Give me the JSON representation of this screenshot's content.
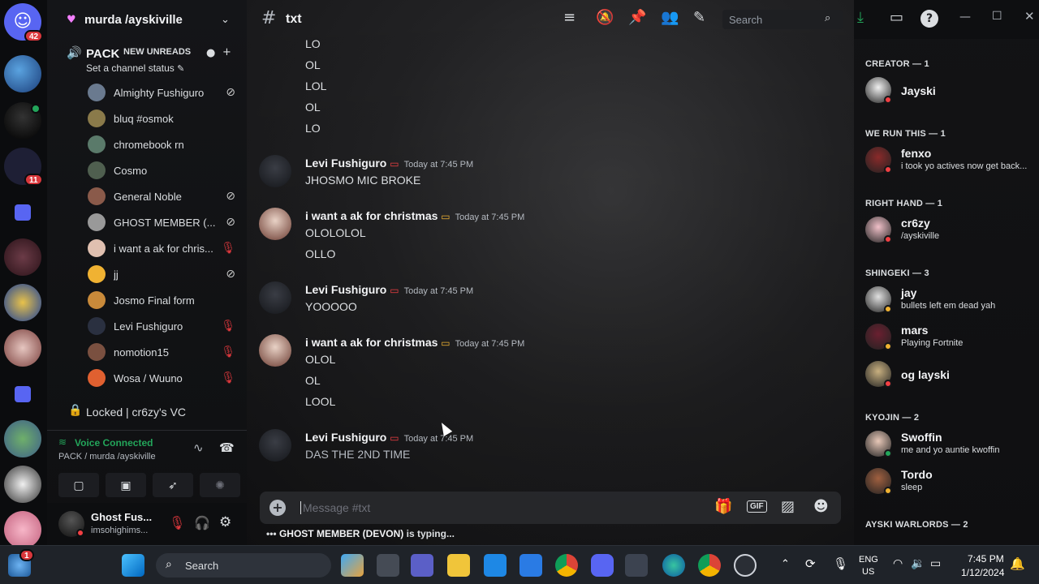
{
  "rail": {
    "badges": [
      "42",
      "11",
      "1"
    ]
  },
  "sidebar": {
    "server_name": "murda /ayskiville",
    "voice_channel": "PACK",
    "new_unreads": "NEW UNREADS",
    "channel_status": "Set a channel status",
    "voice_users": [
      {
        "name": "Almighty Fushiguro",
        "state": "deafened"
      },
      {
        "name": "bluq #osmok",
        "state": ""
      },
      {
        "name": "chromebook rn",
        "state": ""
      },
      {
        "name": "Cosmo",
        "state": ""
      },
      {
        "name": "General Noble",
        "state": "deafened"
      },
      {
        "name": "GHOST MEMBER (...",
        "state": "deafened"
      },
      {
        "name": "i want a ak for chris...",
        "state": "muted"
      },
      {
        "name": "jj",
        "state": "deafened"
      },
      {
        "name": "Josmo Final form",
        "state": ""
      },
      {
        "name": "Levi Fushiguro",
        "state": "muted"
      },
      {
        "name": "nomotion15",
        "state": "muted"
      },
      {
        "name": "Wosa / Wuuno",
        "state": "muted"
      }
    ],
    "locked_channel": "Locked | cr6zy's VC",
    "voice_status": "Voice Connected",
    "voice_location": "PACK / murda /ayskiville",
    "user_name": "Ghost Fus...",
    "user_status": "imsohighims..."
  },
  "topbar": {
    "channel": "txt",
    "search_placeholder": "Search"
  },
  "messages": {
    "top_lines": [
      "LO",
      "OL",
      "LOL",
      "OL",
      "LO"
    ],
    "groups": [
      {
        "author": "Levi Fushiguro",
        "time": "Today at 7:45 PM",
        "lines": [
          "JHOSMO MIC BROKE"
        ]
      },
      {
        "author": "i want a ak for christmas",
        "time": "Today at 7:45 PM",
        "lines": [
          "OLOLOLOL",
          "OLLO"
        ]
      },
      {
        "author": "Levi Fushiguro",
        "time": "Today at 7:45 PM",
        "lines": [
          "YOOOOO"
        ]
      },
      {
        "author": "i want a ak for christmas",
        "time": "Today at 7:45 PM",
        "lines": [
          "OLOL",
          "OL",
          "LOOL"
        ]
      },
      {
        "author": "Levi Fushiguro",
        "time": "Today at 7:45 PM",
        "lines": [
          "DAS THE 2ND TIME"
        ]
      }
    ]
  },
  "composer": {
    "placeholder": "Message #txt",
    "typing_user": "GHOST MEMBER (DEVON)",
    "typing_suffix": " is typing..."
  },
  "members": {
    "categories": [
      "CREATOR — 1",
      "WE RUN THIS — 1",
      "RIGHT HAND — 1",
      "SHINGEKI — 3",
      "KYOJIN — 2",
      "AYSKI WARLORDS — 2"
    ],
    "list": [
      {
        "name": "Jayski",
        "status": ""
      },
      {
        "name": "fenxo",
        "status": "i took yo actives now get back..."
      },
      {
        "name": "cr6zy",
        "status": "/ayskiville"
      },
      {
        "name": "jay",
        "status": "bullets left em dead yah"
      },
      {
        "name": "mars",
        "status": "Playing Fortnite"
      },
      {
        "name": "og layski",
        "status": ""
      },
      {
        "name": "Swoffin",
        "status": "me and yo auntie kwoffin"
      },
      {
        "name": "Tordo",
        "status": "sleep"
      }
    ]
  },
  "taskbar": {
    "search": "Search",
    "lang1": "ENG",
    "lang2": "US",
    "time": "7:45 PM",
    "date": "1/12/2024"
  },
  "colors": {
    "accent": "#5865f2",
    "online": "#23a55a",
    "idle": "#f0b232",
    "dnd": "#f23f43",
    "voice": "#23a55a"
  }
}
